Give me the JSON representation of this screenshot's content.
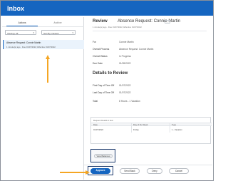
{
  "app": {
    "title": "Inbox"
  },
  "tabs": [
    {
      "label": "Actions"
    },
    {
      "label": "Archive"
    }
  ],
  "filters": {
    "viewing": "Viewing: All",
    "sort": "Sort By: Newest"
  },
  "inbox_item": {
    "title": "Absence Request: Connie Martin",
    "subtitle": "1 minute(s) ago · Due 01/07/2022; Effective 01/07/2022"
  },
  "review": {
    "heading": "Review",
    "title": "Absence Request: Connie Martin",
    "more_label": "···",
    "meta": "1 minute(s) ago · Due 01/07/2022; Effective 01/07/2022",
    "fields": [
      {
        "label": "For",
        "value": "Connie Martin"
      },
      {
        "label": "Overall Process",
        "value": "Absence Request: Connie Martin"
      },
      {
        "label": "Overall Status",
        "value": "In Progress"
      },
      {
        "label": "Due Date",
        "value": "01/09/2022"
      }
    ]
  },
  "details": {
    "heading": "Details to Review",
    "fields": [
      {
        "label": "First Day of Time Off",
        "value": "01/07/2022"
      },
      {
        "label": "Last Day of Time Off",
        "value": "01/07/2022"
      },
      {
        "label": "Total",
        "value": "8 Hours - 1 Vacation"
      }
    ]
  },
  "request_details": {
    "caption": "Request Details  1 item",
    "columns": [
      "Date",
      "Day of the Week",
      "Type"
    ],
    "rows": [
      [
        "01/07/2022",
        "Friday",
        "1 - Vacation"
      ]
    ]
  },
  "buttons": {
    "view_balances": "View Balances",
    "approve": "Approve",
    "send_back": "Send Back",
    "deny": "Deny",
    "cancel": "Cancel"
  },
  "colors": {
    "header": "#1565c0",
    "approve": "#1565c0",
    "annotation_arrow": "#f5a623"
  }
}
